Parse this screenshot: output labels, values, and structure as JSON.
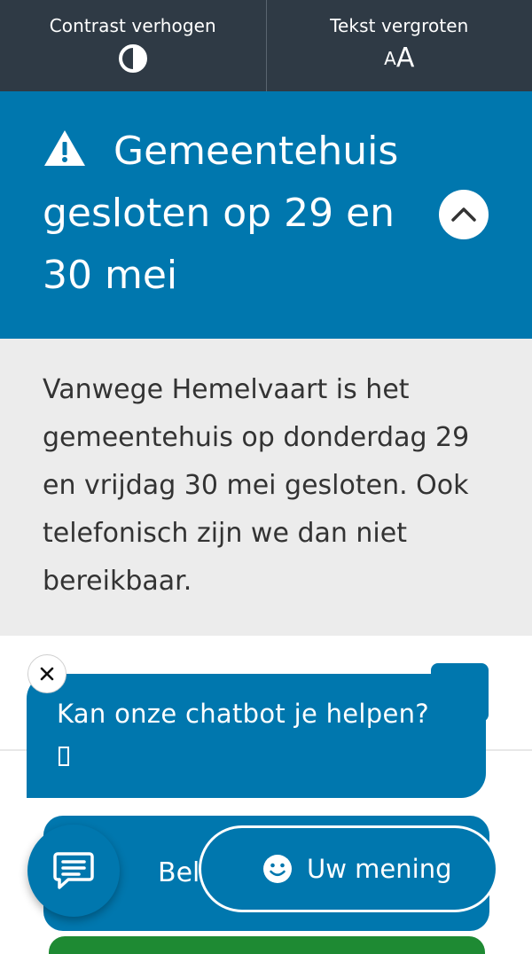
{
  "accessibility_bar": {
    "contrast_label": "Contrast verhogen",
    "text_size_label": "Tekst vergroten",
    "text_size_glyph_small": "A",
    "text_size_glyph_large": "A"
  },
  "alert": {
    "title": "Gemeentehuis gesloten op 29 en 30 mei",
    "body": "Vanwege Hemelvaart is het gemeentehuis op donderdag 29 en vrijdag 30 mei gesloten. Ook telefonisch zijn we dan niet bereikbaar."
  },
  "chatbot": {
    "prompt": "Kan onze chatbot je helpen?"
  },
  "actions": {
    "call_label_partial": "Bel"
  },
  "feedback": {
    "label": "Uw mening"
  },
  "colors": {
    "brand_blue": "#0077ae",
    "top_bar": "#2f3a45",
    "body_grey": "#ececec",
    "green": "#1e8a33"
  }
}
